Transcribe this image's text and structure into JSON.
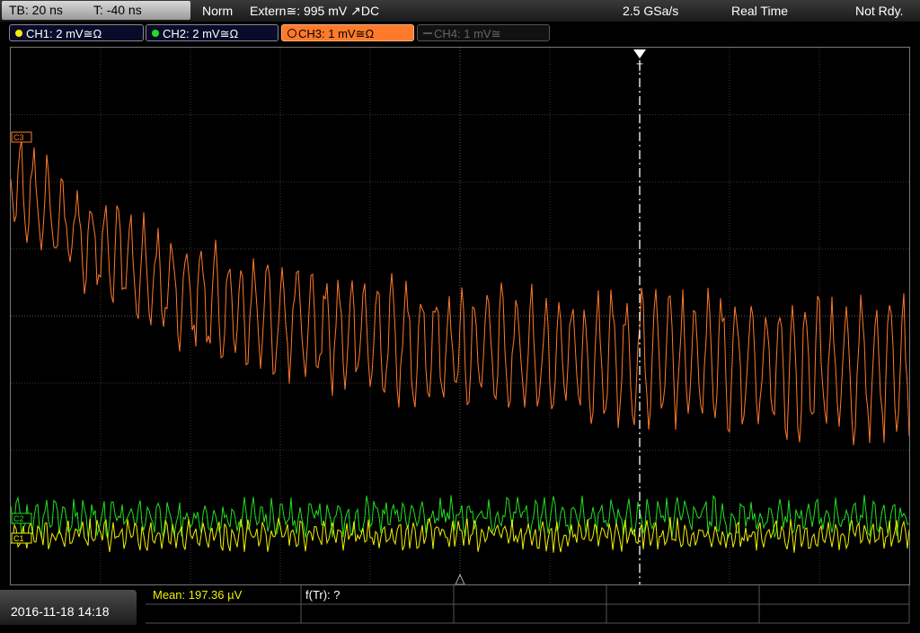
{
  "topbar": {
    "timebase": "TB: 20 ns",
    "trigger_time": "T: -40 ns",
    "trigger_mode": "Norm",
    "trigger_source": "Extern≅: 995 mV ↗DC",
    "sample_rate": "2.5 GSa/s",
    "acq_mode": "Real Time",
    "status": "Not Rdy."
  },
  "channels": [
    {
      "label": "CH1: 2 mV≅Ω",
      "color": "#f0f000",
      "active": true
    },
    {
      "label": "CH2: 2 mV≅Ω",
      "color": "#20e020",
      "active": true
    },
    {
      "label": "CH3: 1 mV≅Ω",
      "color": "#ff7a2a",
      "active": true
    },
    {
      "label": "CH4: 1 mV≅",
      "color": "#777777",
      "active": false
    }
  ],
  "markers": {
    "ch3": "C3",
    "ch2": "C2",
    "ch1": "C1",
    "trigger": "T"
  },
  "bottombar": {
    "datetime": "2016-11-18 14:18",
    "mean": "Mean: 197.36 µV",
    "freq": "f(Tr): ?"
  },
  "colors": {
    "ch1": "#f0f000",
    "ch2": "#20e020",
    "ch3": "#ff7a2a",
    "grid": "#444444"
  }
}
